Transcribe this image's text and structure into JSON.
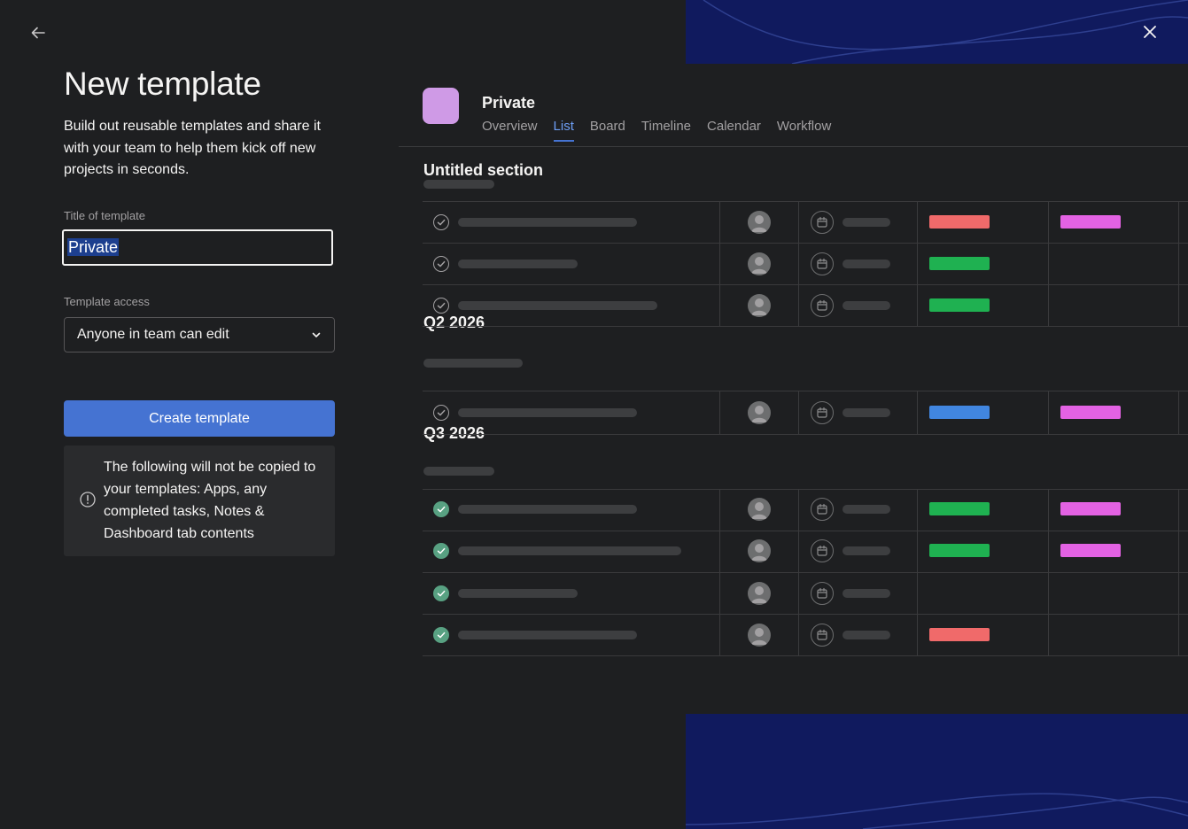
{
  "left": {
    "title": "New template",
    "description": "Build out reusable templates and share it with your team to help them kick off new projects in seconds.",
    "title_label": "Title of template",
    "title_value": "Private",
    "access_label": "Template access",
    "access_value": "Anyone in team can edit",
    "create_label": "Create template",
    "notice": "The following will not be copied to your templates: Apps, any completed tasks, Notes & Dashboard tab contents"
  },
  "preview": {
    "project_name": "Private",
    "tabs": [
      "Overview",
      "List",
      "Board",
      "Timeline",
      "Calendar",
      "Workflow"
    ],
    "active_tab": "List",
    "sections": [
      {
        "title": "Untitled section"
      },
      {
        "title": "Q2 2026"
      },
      {
        "title": "Q3 2026"
      }
    ]
  },
  "colors": {
    "accent": "#4573d2",
    "project_color": "#cf9ae6",
    "tag_red": "#f06a6a",
    "tag_green": "#1fb151",
    "tag_blue": "#4186e0",
    "tag_pink": "#e362e3",
    "completed_check": "#58a182",
    "decor_navy": "#101a5e"
  },
  "icons": {
    "back": "arrow-left-icon",
    "close": "close-icon",
    "dropdown": "chevron-down-icon",
    "notice": "exclamation-circle-icon",
    "task_check": "check-circle-icon",
    "assignee": "avatar-icon",
    "due_date": "calendar-icon"
  }
}
